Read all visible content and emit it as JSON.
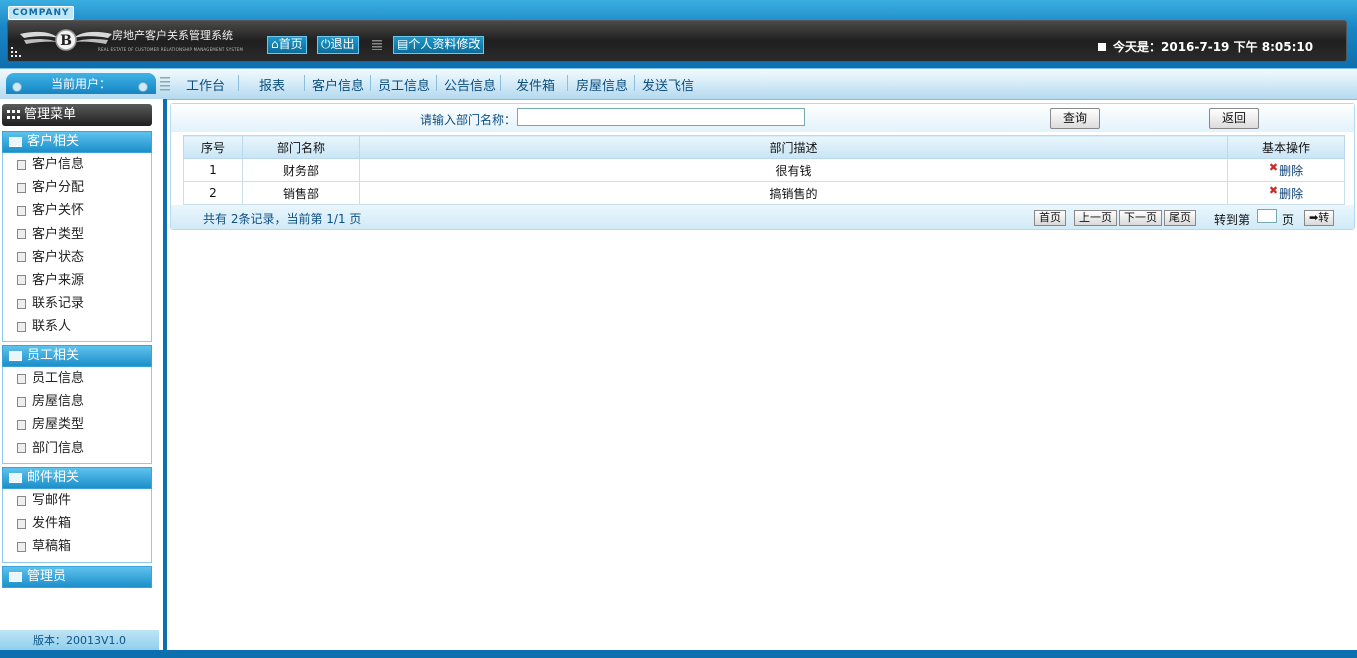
{
  "header": {
    "company": "COMPANY",
    "system_title": "房地产客户关系管理系统",
    "system_subtitle": "REAL ESTATE OF CUSTOMER RELATIONSHIP MANAGEMENT SYSTEM",
    "home_label": "首页",
    "logout_label": "退出",
    "profile_label": "个人资料修改",
    "today_label": "今天是：2016-7-19 下午 8:05:10"
  },
  "nav": {
    "current_user_label": "当前用户：",
    "items": [
      "工作台",
      "报表",
      "客户信息",
      "员工信息",
      "公告信息",
      "发件箱",
      "房屋信息",
      "发送飞信"
    ]
  },
  "sidebar": {
    "title": "管理菜单",
    "sections": [
      {
        "label": "客户相关",
        "items": [
          "客户信息",
          "客户分配",
          "客户关怀",
          "客户类型",
          "客户状态",
          "客户来源",
          "联系记录",
          "联系人"
        ]
      },
      {
        "label": "员工相关",
        "items": [
          "员工信息",
          "房屋信息",
          "房屋类型",
          "部门信息"
        ]
      },
      {
        "label": "邮件相关",
        "items": [
          "写邮件",
          "发件箱",
          "草稿箱"
        ]
      },
      {
        "label": "管理员",
        "items": []
      }
    ],
    "version": "版本：20013V1.0"
  },
  "search": {
    "label": "请输入部门名称：",
    "value": "",
    "query_button": "查询",
    "back_button": "返回"
  },
  "table": {
    "columns": [
      "序号",
      "部门名称",
      "部门描述",
      "基本操作"
    ],
    "rows": [
      {
        "no": "1",
        "name": "财务部",
        "desc": "很有钱",
        "action": "删除"
      },
      {
        "no": "2",
        "name": "销售部",
        "desc": "搞销售的",
        "action": "删除"
      }
    ]
  },
  "pager": {
    "summary": "共有 2条记录，当前第 1/1 页",
    "first": "首页",
    "prev": "上一页",
    "next": "下一页",
    "last": "尾页",
    "jump_label": "转到第",
    "page_label": "页",
    "go_label": "➡转"
  },
  "colors": {
    "header_blue": "#1a86c6",
    "dark_bar": "#1f1f1f",
    "accent": "#0e6fae"
  }
}
